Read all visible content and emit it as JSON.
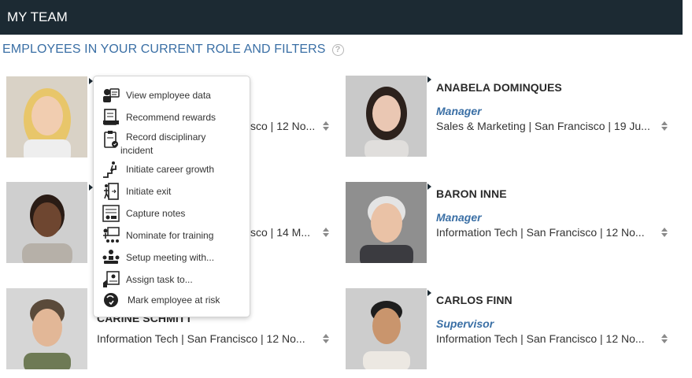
{
  "header": {
    "title": "MY TEAM"
  },
  "section": {
    "title": "EMPLOYEES IN YOUR CURRENT ROLE AND FILTERS",
    "help_icon": "question-circle-icon",
    "help_glyph": "?"
  },
  "left_column": [
    {
      "meta": "sco | 12 No..."
    },
    {
      "meta": "sco | 14 M..."
    },
    {
      "name": "CARINE SCHMITT",
      "meta": "Information Tech | San Francisco | 12 No..."
    }
  ],
  "right_column": [
    {
      "name": "ANABELA DOMINQUES",
      "role": "Manager",
      "meta": "Sales & Marketing | San Francisco | 19 Ju..."
    },
    {
      "name": "BARON INNE",
      "role": "Manager",
      "meta": "Information Tech | San Francisco | 12 No..."
    },
    {
      "name": "CARLOS FINN",
      "role": "Supervisor",
      "meta": "Information Tech | San Francisco | 12 No..."
    }
  ],
  "context_menu": {
    "items": [
      {
        "label": "View employee data",
        "icon": "employee-data-icon"
      },
      {
        "label": "Recommend rewards",
        "icon": "rewards-icon"
      },
      {
        "label": "Record disciplinary",
        "label2": "incident",
        "icon": "disciplinary-icon"
      },
      {
        "label": "Initiate career growth",
        "icon": "career-growth-icon"
      },
      {
        "label": "Initiate exit",
        "icon": "exit-icon"
      },
      {
        "label": "Capture notes",
        "icon": "notes-icon"
      },
      {
        "label": "Nominate for training",
        "icon": "training-icon"
      },
      {
        "label": "Setup meeting with...",
        "icon": "meeting-icon"
      },
      {
        "label": "Assign task to...",
        "icon": "assign-task-icon"
      },
      {
        "label": "Mark employee at risk",
        "icon": "risk-icon"
      }
    ]
  },
  "colors": {
    "header_bg": "#1c2a33",
    "accent": "#3a6fa5"
  }
}
